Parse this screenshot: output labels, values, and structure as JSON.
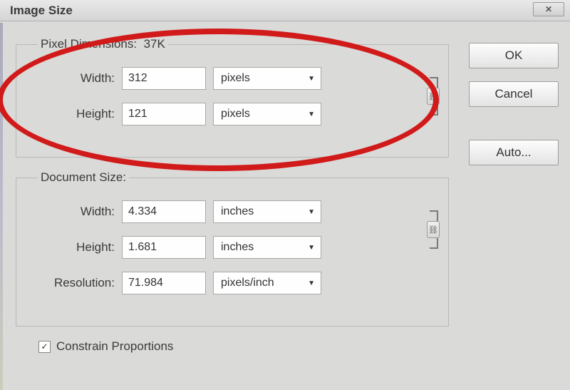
{
  "window": {
    "title": "Image Size"
  },
  "pixelDimensions": {
    "legend": "Pixel Dimensions:",
    "sizeLabel": "37K",
    "widthLabel": "Width:",
    "widthValue": "312",
    "widthUnit": "pixels",
    "heightLabel": "Height:",
    "heightValue": "121",
    "heightUnit": "pixels"
  },
  "documentSize": {
    "legend": "Document Size:",
    "widthLabel": "Width:",
    "widthValue": "4.334",
    "widthUnit": "inches",
    "heightLabel": "Height:",
    "heightValue": "1.681",
    "heightUnit": "inches",
    "resolutionLabel": "Resolution:",
    "resolutionValue": "71.984",
    "resolutionUnit": "pixels/inch"
  },
  "options": {
    "constrainProportions": "Constrain Proportions",
    "constrainChecked": true
  },
  "buttons": {
    "ok": "OK",
    "cancel": "Cancel",
    "auto": "Auto..."
  }
}
